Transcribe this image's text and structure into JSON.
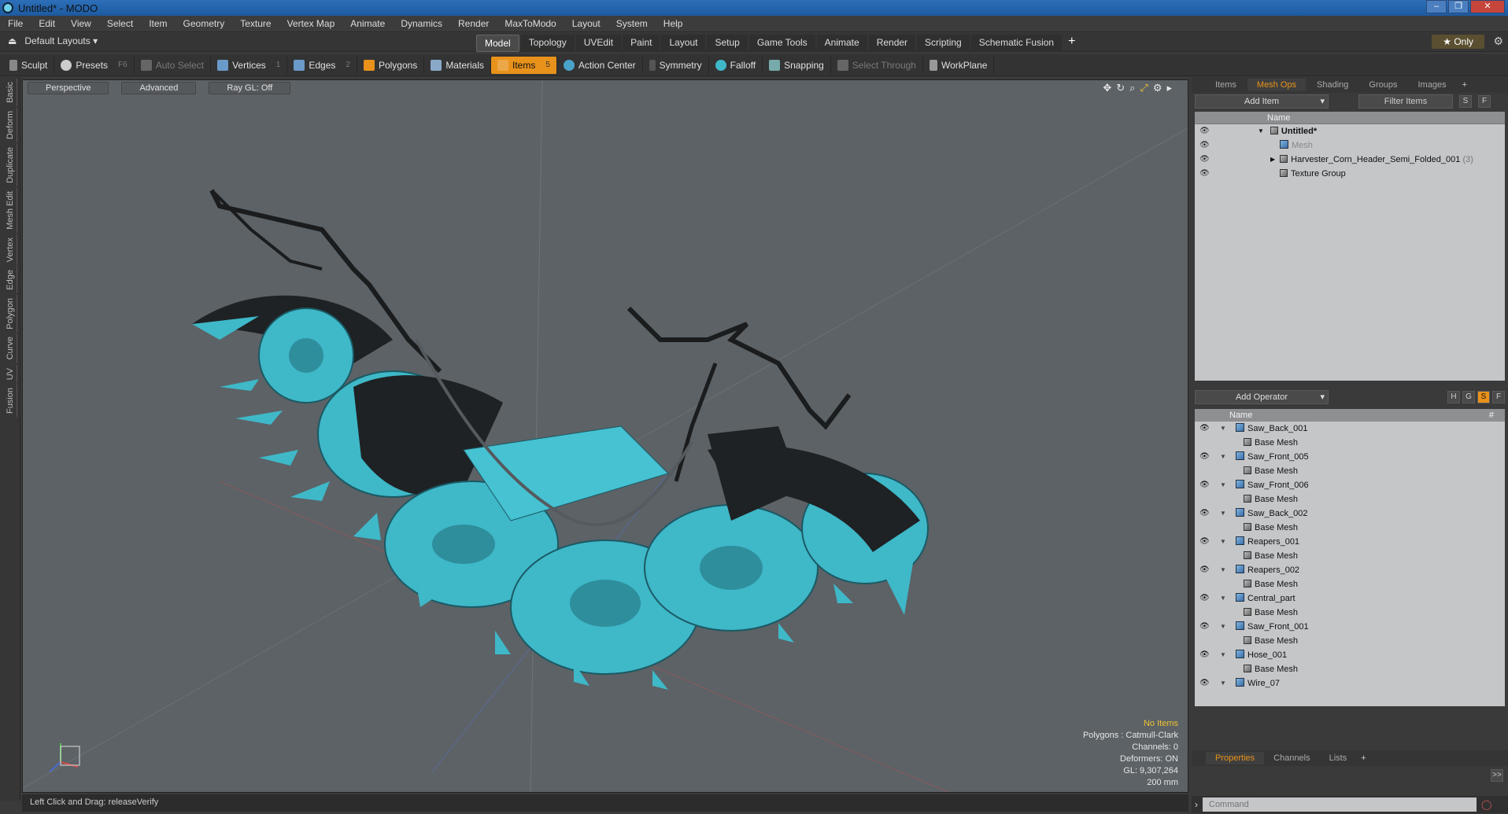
{
  "titlebar": {
    "title": "Untitled* - MODO",
    "min": "–",
    "max": "❐",
    "close": "✕"
  },
  "menu": [
    "File",
    "Edit",
    "View",
    "Select",
    "Item",
    "Geometry",
    "Texture",
    "Vertex Map",
    "Animate",
    "Dynamics",
    "Render",
    "MaxToModo",
    "Layout",
    "System",
    "Help"
  ],
  "layout": {
    "default_layouts": "Default Layouts ▾",
    "tabs": [
      "Model",
      "Topology",
      "UVEdit",
      "Paint",
      "Layout",
      "Setup",
      "Game Tools",
      "Animate",
      "Render",
      "Scripting",
      "Schematic Fusion"
    ],
    "active_tab": "Model",
    "only": "★ Only"
  },
  "toolbar": {
    "sculpt": "Sculpt",
    "presets": "Presets",
    "presets_key": "F6",
    "auto_select": "Auto Select",
    "vertices": "Vertices",
    "vertices_key": "1",
    "edges": "Edges",
    "edges_key": "2",
    "polygons": "Polygons",
    "materials": "Materials",
    "items": "Items",
    "items_key": "5",
    "action_center": "Action Center",
    "symmetry": "Symmetry",
    "falloff": "Falloff",
    "snapping": "Snapping",
    "select_through": "Select Through",
    "workplane": "WorkPlane"
  },
  "left_tabs": [
    "Basic",
    "Deform",
    "Duplicate",
    "Mesh Edit",
    "Vertex",
    "Edge",
    "Polygon",
    "Curve",
    "UV",
    "Fusion"
  ],
  "viewport": {
    "perspective": "Perspective",
    "advanced": "Advanced",
    "raygl": "Ray GL: Off",
    "info": {
      "no_items": "No Items",
      "polygons": "Polygons : Catmull-Clark",
      "channels": "Channels: 0",
      "deformers": "Deformers: ON",
      "gl": "GL: 9,307,264",
      "scale": "200 mm"
    }
  },
  "status": "Left Click and Drag:  releaseVerify",
  "items_panel": {
    "tabs": [
      "Items",
      "Mesh Ops",
      "Shading",
      "Groups",
      "Images"
    ],
    "active_tab": "Mesh Ops",
    "add_item": "Add Item",
    "filter_items": "Filter Items",
    "s": "S",
    "f": "F",
    "name_header": "Name",
    "tree": [
      {
        "label": "Untitled*",
        "indent": 0
      },
      {
        "label": "Mesh",
        "indent": 1
      },
      {
        "label": "Harvester_Corn_Header_Semi_Folded_001",
        "suffix": "(3)",
        "indent": 1
      },
      {
        "label": "Texture Group",
        "indent": 1
      }
    ]
  },
  "operator_panel": {
    "add_operator": "Add Operator",
    "name_header": "Name",
    "hash": "#",
    "btn_h": "H",
    "btn_g": "G",
    "btn_s": "S",
    "btn_f": "F",
    "rows": [
      "Saw_Back_001",
      "Base Mesh",
      "Saw_Front_005",
      "Base Mesh",
      "Saw_Front_006",
      "Base Mesh",
      "Saw_Back_002",
      "Base Mesh",
      "Reapers_001",
      "Base Mesh",
      "Reapers_002",
      "Base Mesh",
      "Central_part",
      "Base Mesh",
      "Saw_Front_001",
      "Base Mesh",
      "Hose_001",
      "Base Mesh",
      "Wire_07"
    ]
  },
  "properties": {
    "tabs": [
      "Properties",
      "Channels",
      "Lists"
    ],
    "active_tab": "Properties",
    "command_placeholder": "Command",
    "expand": ">>"
  },
  "colors": {
    "accent": "#e8921b",
    "mesh": "#3fb8c8",
    "viewport_bg": "#5c6266"
  }
}
